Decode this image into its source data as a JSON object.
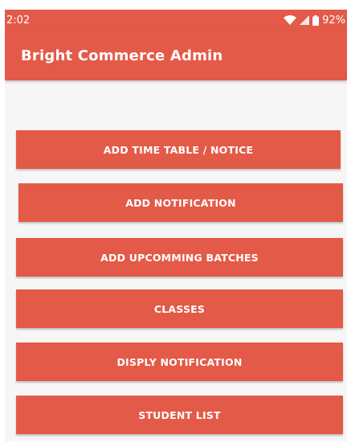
{
  "status_bar": {
    "time": "2:02",
    "battery": "92%",
    "icons": [
      "wifi-icon",
      "signal-icon",
      "battery-icon"
    ]
  },
  "app_bar": {
    "title": "Bright Commerce Admin"
  },
  "menu": {
    "items": [
      {
        "label": "ADD TIME TABLE / NOTICE"
      },
      {
        "label": "ADD NOTIFICATION"
      },
      {
        "label": "ADD UPCOMMING BATCHES"
      },
      {
        "label": "CLASSES"
      },
      {
        "label": "DISPLY NOTIFICATION"
      },
      {
        "label": "STUDENT LIST"
      }
    ]
  },
  "colors": {
    "primary": "#e45a48",
    "background": "#f6f6f6",
    "text_on_primary": "#ffffff"
  }
}
